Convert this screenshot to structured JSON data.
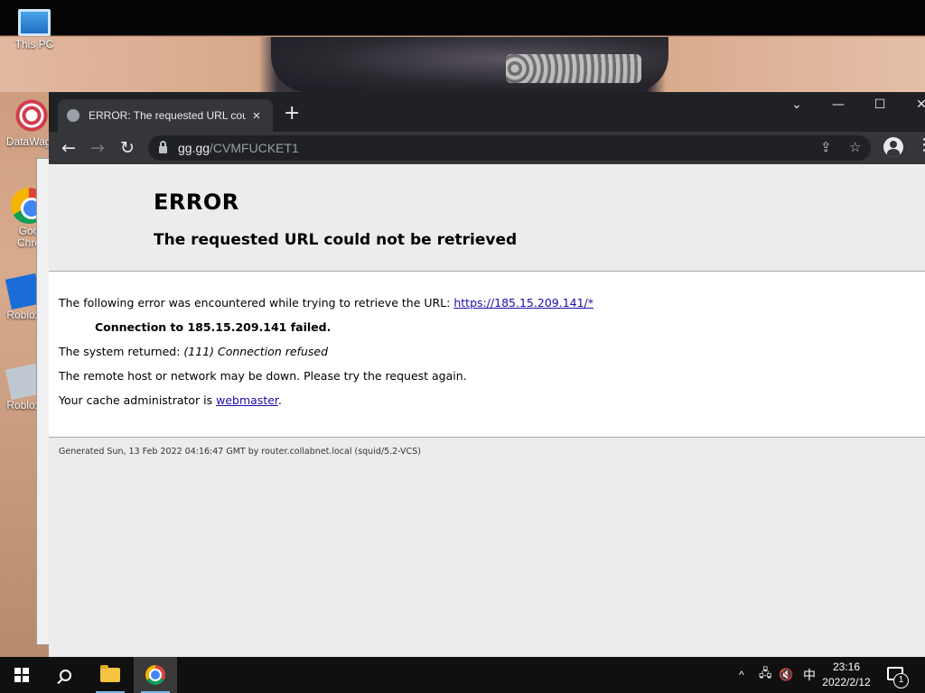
{
  "desktop": {
    "icons": [
      {
        "label": "This PC",
        "icon": "this-pc-icon"
      },
      {
        "label": "DataWago",
        "icon": "datawago-icon"
      },
      {
        "label": "Goo\nChro",
        "icon": "chrome-icon"
      },
      {
        "label": "Roblox",
        "icon": "roblox-icon"
      },
      {
        "label": "Roblox",
        "icon": "roblox-studio-icon"
      }
    ]
  },
  "browser": {
    "tab": {
      "title": "ERROR: The requested URL could not be retrieved",
      "close": "×"
    },
    "new_tab": "+",
    "window_controls": {
      "dropdown": "⌄",
      "minimize": "—",
      "maximize": "☐",
      "close": "✕"
    },
    "nav": {
      "back": "←",
      "forward": "→",
      "reload": "↻"
    },
    "address": {
      "host": "gg.gg",
      "path": "/CVMFUCKET1"
    },
    "toolbar_icons": {
      "share": "⇪",
      "bookmark": "☆",
      "menu": "⋮"
    }
  },
  "page": {
    "title": "ERROR",
    "subtitle": "The requested URL could not be retrieved",
    "line1_prefix": "The following error was encountered while trying to retrieve the URL: ",
    "line1_link": "https://185.15.209.141/*",
    "line2": "Connection to 185.15.209.141 failed.",
    "line3_prefix": "The system returned: ",
    "line3_em": "(111) Connection refused",
    "line4": "The remote host or network may be down. Please try the request again.",
    "line5_prefix": "Your cache administrator is ",
    "line5_link": "webmaster",
    "line5_suffix": ".",
    "footer": "Generated Sun, 13 Feb 2022 04:16:47 GMT by router.collabnet.local (squid/5.2-VCS)"
  },
  "taskbar": {
    "tray": {
      "chevron": "^",
      "network": "🖧",
      "volume": "🔇",
      "ime": "中"
    },
    "clock": {
      "time": "23:16",
      "date": "2022/2/12"
    },
    "notifications": "1"
  },
  "colors": {
    "titlebar": "#202124",
    "toolbar": "#35363a",
    "link": "#1a0dab",
    "taskbar": "#101010"
  }
}
